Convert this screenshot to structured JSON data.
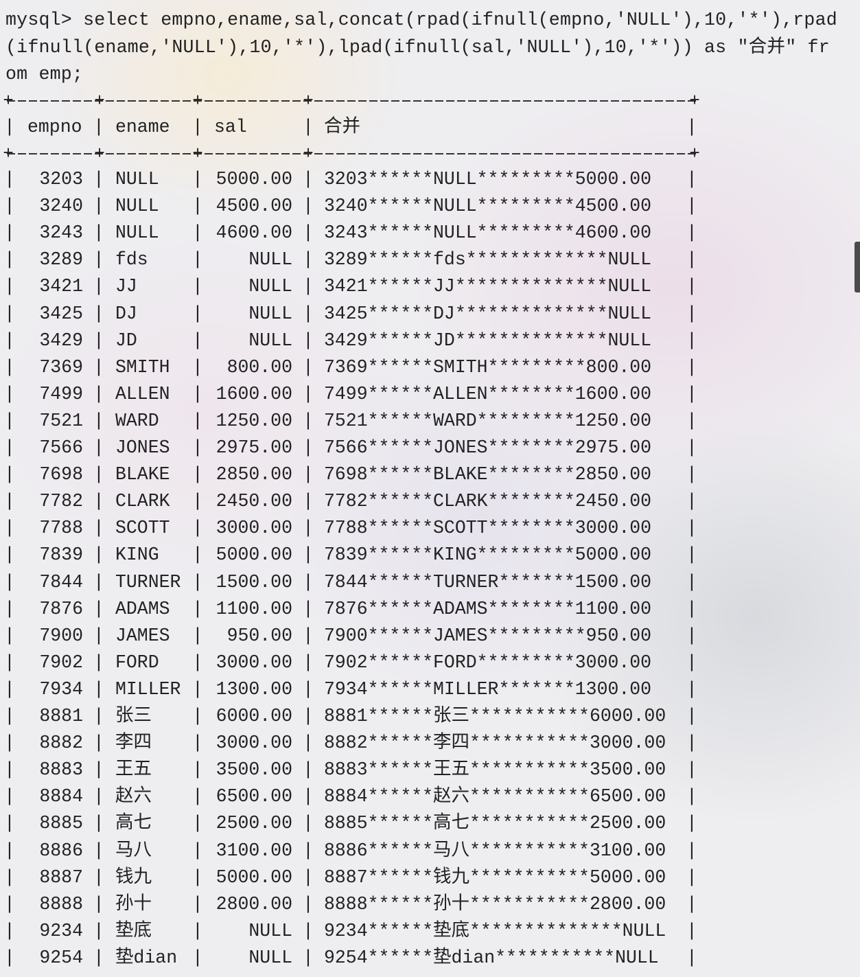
{
  "query": {
    "lines": [
      "mysql> select empno,ename,sal,concat(rpad(ifnull(empno,'NULL'),10,'*'),rpad",
      "(ifnull(ename,'NULL'),10,'*'),lpad(ifnull(sal,'NULL'),10,'*')) as \"合并\" fr",
      "om emp;"
    ]
  },
  "table": {
    "border": {
      "corner": "+",
      "pipe": "|"
    },
    "headers": [
      "empno",
      "ename",
      "sal",
      "合并"
    ],
    "rows": [
      [
        "3203",
        "NULL",
        "5000.00",
        "3203******NULL*********5000.00"
      ],
      [
        "3240",
        "NULL",
        "4500.00",
        "3240******NULL*********4500.00"
      ],
      [
        "3243",
        "NULL",
        "4600.00",
        "3243******NULL*********4600.00"
      ],
      [
        "3289",
        "fds",
        "NULL",
        "3289******fds*************NULL"
      ],
      [
        "3421",
        "JJ",
        "NULL",
        "3421******JJ**************NULL"
      ],
      [
        "3425",
        "DJ",
        "NULL",
        "3425******DJ**************NULL"
      ],
      [
        "3429",
        "JD",
        "NULL",
        "3429******JD**************NULL"
      ],
      [
        "7369",
        "SMITH",
        "800.00",
        "7369******SMITH*********800.00"
      ],
      [
        "7499",
        "ALLEN",
        "1600.00",
        "7499******ALLEN********1600.00"
      ],
      [
        "7521",
        "WARD",
        "1250.00",
        "7521******WARD*********1250.00"
      ],
      [
        "7566",
        "JONES",
        "2975.00",
        "7566******JONES********2975.00"
      ],
      [
        "7698",
        "BLAKE",
        "2850.00",
        "7698******BLAKE********2850.00"
      ],
      [
        "7782",
        "CLARK",
        "2450.00",
        "7782******CLARK********2450.00"
      ],
      [
        "7788",
        "SCOTT",
        "3000.00",
        "7788******SCOTT********3000.00"
      ],
      [
        "7839",
        "KING",
        "5000.00",
        "7839******KING*********5000.00"
      ],
      [
        "7844",
        "TURNER",
        "1500.00",
        "7844******TURNER*******1500.00"
      ],
      [
        "7876",
        "ADAMS",
        "1100.00",
        "7876******ADAMS********1100.00"
      ],
      [
        "7900",
        "JAMES",
        "950.00",
        "7900******JAMES*********950.00"
      ],
      [
        "7902",
        "FORD",
        "3000.00",
        "7902******FORD*********3000.00"
      ],
      [
        "7934",
        "MILLER",
        "1300.00",
        "7934******MILLER*******1300.00"
      ],
      [
        "8881",
        "张三",
        "6000.00",
        "8881******张三***********6000.00"
      ],
      [
        "8882",
        "李四",
        "3000.00",
        "8882******李四***********3000.00"
      ],
      [
        "8883",
        "王五",
        "3500.00",
        "8883******王五***********3500.00"
      ],
      [
        "8884",
        "赵六",
        "6500.00",
        "8884******赵六***********6500.00"
      ],
      [
        "8885",
        "高七",
        "2500.00",
        "8885******高七***********2500.00"
      ],
      [
        "8886",
        "马八",
        "3100.00",
        "8886******马八***********3100.00"
      ],
      [
        "8887",
        "钱九",
        "5000.00",
        "8887******钱九***********5000.00"
      ],
      [
        "8888",
        "孙十",
        "2800.00",
        "8888******孙十***********2800.00"
      ],
      [
        "9234",
        "垫底",
        "NULL",
        "9234******垫底**************NULL"
      ],
      [
        "9254",
        "垫dian",
        "NULL",
        "9254******垫dian***********NULL"
      ]
    ]
  }
}
